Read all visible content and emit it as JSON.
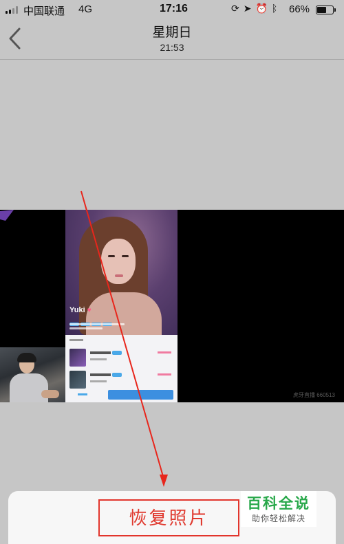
{
  "status_bar": {
    "carrier": "中国联通",
    "network": "4G",
    "time": "17:16",
    "battery_percent": "66%",
    "battery_level": 0.66,
    "icons": [
      "signal-icon",
      "rotation-lock-icon",
      "location-icon",
      "alarm-icon",
      "bluetooth-icon",
      "battery-icon"
    ]
  },
  "header": {
    "back_icon": "chevron-left-icon",
    "title": "星期日",
    "subtitle": "21:53"
  },
  "photo": {
    "streamer_name": "Yuki",
    "watermark": "虎牙直播 660513"
  },
  "action_sheet": {
    "restore_label": "恢复照片"
  },
  "logo": {
    "title": "百科全说",
    "slogan": "助你轻松解决"
  },
  "colors": {
    "background": "#c6c6c6",
    "accent_red": "#e2352c",
    "logo_green": "#28a84a",
    "arrow_red": "#e8261c"
  }
}
